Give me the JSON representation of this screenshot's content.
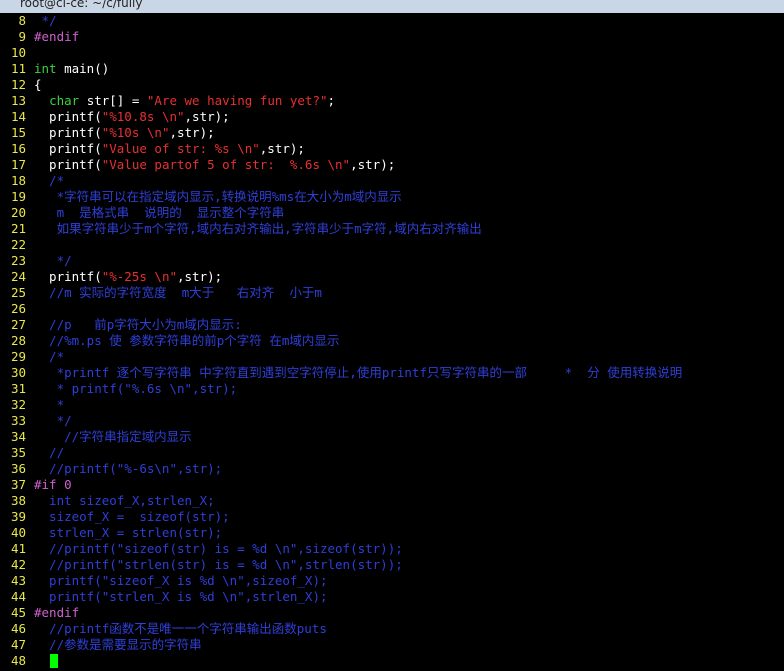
{
  "window": {
    "title": "root@cl-ce: ~/c/fully"
  },
  "editor": {
    "lines": [
      {
        "n": "8",
        "segs": [
          {
            "t": " */",
            "c": "comment"
          }
        ]
      },
      {
        "n": "9",
        "segs": [
          {
            "t": "#endif",
            "c": "pre"
          }
        ]
      },
      {
        "n": "10",
        "segs": []
      },
      {
        "n": "11",
        "segs": [
          {
            "t": "int",
            "c": "type"
          },
          {
            "t": " main()",
            "c": "norm"
          }
        ]
      },
      {
        "n": "12",
        "segs": [
          {
            "t": "{",
            "c": "norm"
          }
        ]
      },
      {
        "n": "13",
        "segs": [
          {
            "t": "  ",
            "c": "norm"
          },
          {
            "t": "char",
            "c": "type"
          },
          {
            "t": " str[] = ",
            "c": "norm"
          },
          {
            "t": "\"Are we having fun yet?\"",
            "c": "str"
          },
          {
            "t": ";",
            "c": "norm"
          }
        ]
      },
      {
        "n": "14",
        "segs": [
          {
            "t": "  printf(",
            "c": "norm"
          },
          {
            "t": "\"%10.8s \\n\"",
            "c": "str"
          },
          {
            "t": ",str);",
            "c": "norm"
          }
        ]
      },
      {
        "n": "15",
        "segs": [
          {
            "t": "  printf(",
            "c": "norm"
          },
          {
            "t": "\"%10s \\n\"",
            "c": "str"
          },
          {
            "t": ",str);",
            "c": "norm"
          }
        ]
      },
      {
        "n": "16",
        "segs": [
          {
            "t": "  printf(",
            "c": "norm"
          },
          {
            "t": "\"Value of str: %s \\n\"",
            "c": "str"
          },
          {
            "t": ",str);",
            "c": "norm"
          }
        ]
      },
      {
        "n": "17",
        "segs": [
          {
            "t": "  printf(",
            "c": "norm"
          },
          {
            "t": "\"Value partof 5 of str:  %.6s \\n\"",
            "c": "str"
          },
          {
            "t": ",str);",
            "c": "norm"
          }
        ]
      },
      {
        "n": "18",
        "segs": [
          {
            "t": "  /*",
            "c": "comment"
          }
        ]
      },
      {
        "n": "19",
        "segs": [
          {
            "t": "   *字符串可以在指定域内显示,转换说明%ms在大小为m域内显示",
            "c": "comment"
          }
        ]
      },
      {
        "n": "20",
        "segs": [
          {
            "t": "   m  是格式串  说明的  显示整个字符串",
            "c": "comment"
          }
        ]
      },
      {
        "n": "21",
        "segs": [
          {
            "t": "   如果字符串少于m个字符,域内右对齐输出,字符串少于m字符,域内右对齐输出",
            "c": "comment"
          }
        ]
      },
      {
        "n": "22",
        "segs": []
      },
      {
        "n": "23",
        "segs": [
          {
            "t": "   */",
            "c": "comment"
          }
        ]
      },
      {
        "n": "24",
        "segs": [
          {
            "t": "  printf(",
            "c": "norm"
          },
          {
            "t": "\"%-25s \\n\"",
            "c": "str"
          },
          {
            "t": ",str);",
            "c": "norm"
          }
        ]
      },
      {
        "n": "25",
        "segs": [
          {
            "t": "  //m 实际的字符宽度  m大于   右对齐  小于m",
            "c": "comment"
          }
        ]
      },
      {
        "n": "26",
        "segs": []
      },
      {
        "n": "27",
        "segs": [
          {
            "t": "  //p   前p字符大小为m域内显示:",
            "c": "comment"
          }
        ]
      },
      {
        "n": "28",
        "segs": [
          {
            "t": "  //%m.ps 使 参数字符串的前p个字符 在m域内显示",
            "c": "comment"
          }
        ]
      },
      {
        "n": "29",
        "segs": [
          {
            "t": "  /*",
            "c": "comment"
          }
        ]
      },
      {
        "n": "30",
        "segs": [
          {
            "t": "   *printf 逐个写字符串 中字符直到遇到空字符停止,使用printf只写字符串的一部     *  分 使用转换说明",
            "c": "comment"
          }
        ]
      },
      {
        "n": "31",
        "segs": [
          {
            "t": "   * printf(\"%.6s \\n\",str);",
            "c": "comment"
          }
        ]
      },
      {
        "n": "32",
        "segs": [
          {
            "t": "   *",
            "c": "comment"
          }
        ]
      },
      {
        "n": "33",
        "segs": [
          {
            "t": "   */",
            "c": "comment"
          }
        ]
      },
      {
        "n": "34",
        "segs": [
          {
            "t": "    //字符串指定域内显示",
            "c": "comment"
          }
        ]
      },
      {
        "n": "35",
        "segs": [
          {
            "t": "  //",
            "c": "comment"
          }
        ]
      },
      {
        "n": "36",
        "segs": [
          {
            "t": "  //printf(\"%-6s\\n\",str);",
            "c": "comment"
          }
        ]
      },
      {
        "n": "37",
        "segs": [
          {
            "t": "#if 0",
            "c": "pre"
          }
        ]
      },
      {
        "n": "38",
        "segs": [
          {
            "t": "  int sizeof_X,strlen_X;",
            "c": "comment"
          }
        ]
      },
      {
        "n": "39",
        "segs": [
          {
            "t": "  sizeof_X =  sizeof(str);",
            "c": "comment"
          }
        ]
      },
      {
        "n": "40",
        "segs": [
          {
            "t": "  strlen_X = strlen(str);",
            "c": "comment"
          }
        ]
      },
      {
        "n": "41",
        "segs": [
          {
            "t": "  //printf(\"sizeof(str) is = %d \\n\",sizeof(str));",
            "c": "comment"
          }
        ]
      },
      {
        "n": "42",
        "segs": [
          {
            "t": "  //printf(\"strlen(str) is = %d \\n\",strlen(str));",
            "c": "comment"
          }
        ]
      },
      {
        "n": "43",
        "segs": [
          {
            "t": "  printf(\"sizeof_X is %d \\n\",sizeof_X);",
            "c": "comment"
          }
        ]
      },
      {
        "n": "44",
        "segs": [
          {
            "t": "  printf(\"strlen_X is %d \\n\",strlen_X);",
            "c": "comment"
          }
        ]
      },
      {
        "n": "45",
        "segs": [
          {
            "t": "#endif",
            "c": "pre"
          }
        ]
      },
      {
        "n": "46",
        "segs": [
          {
            "t": "  //printf函数不是唯一一个字符串输出函数puts",
            "c": "comment"
          }
        ]
      },
      {
        "n": "47",
        "segs": [
          {
            "t": "  //参数是需要显示的字符串",
            "c": "comment"
          }
        ]
      },
      {
        "n": "48",
        "segs": []
      }
    ]
  }
}
